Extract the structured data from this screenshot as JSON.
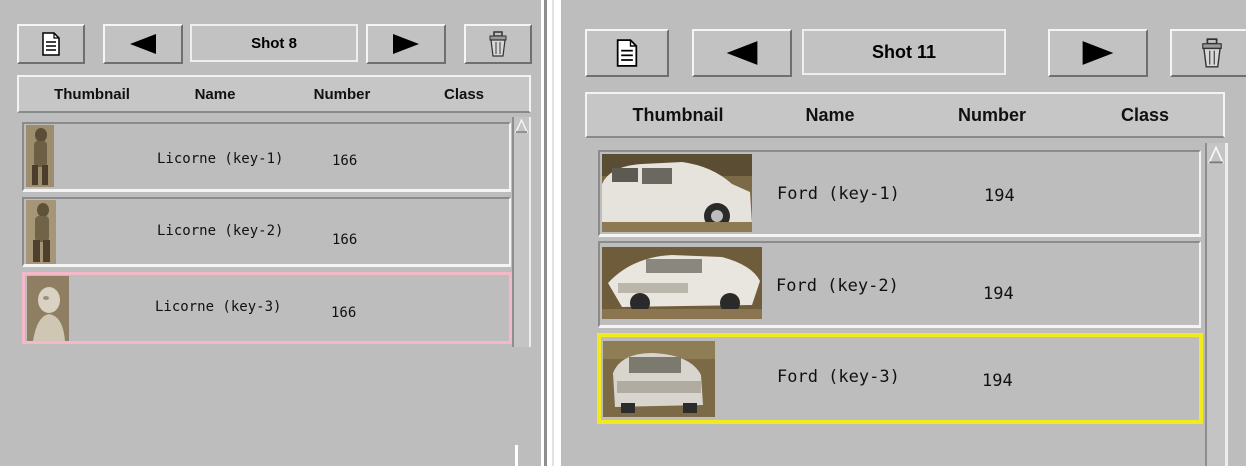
{
  "panel_a": {
    "toolbar": {
      "title": "Shot 8"
    },
    "columns": {
      "thumbnail": "Thumbnail",
      "name": "Name",
      "number": "Number",
      "class": "Class"
    },
    "rows": [
      {
        "name": "Licorne (key-1)",
        "number": "166",
        "class": ""
      },
      {
        "name": "Licorne (key-2)",
        "number": "166",
        "class": ""
      },
      {
        "name": "Licorne (key-3)",
        "number": "166",
        "class": ""
      }
    ]
  },
  "panel_b": {
    "toolbar": {
      "title": "Shot 11"
    },
    "columns": {
      "thumbnail": "Thumbnail",
      "name": "Name",
      "number": "Number",
      "class": "Class"
    },
    "rows": [
      {
        "name": "Ford (key-1)",
        "number": "194",
        "class": ""
      },
      {
        "name": "Ford (key-2)",
        "number": "194",
        "class": ""
      },
      {
        "name": "Ford (key-3)",
        "number": "194",
        "class": ""
      }
    ]
  },
  "icons": {
    "document": "document-icon",
    "previous": "left-arrow-icon",
    "next": "right-arrow-icon",
    "delete": "trash-icon",
    "scroll_up": "scroll-up-arrow-icon"
  },
  "colors": {
    "panel_bg": "#bdbdbd",
    "selection_pink": "#f4b8c8",
    "selection_yellow": "#f2ea1c"
  }
}
